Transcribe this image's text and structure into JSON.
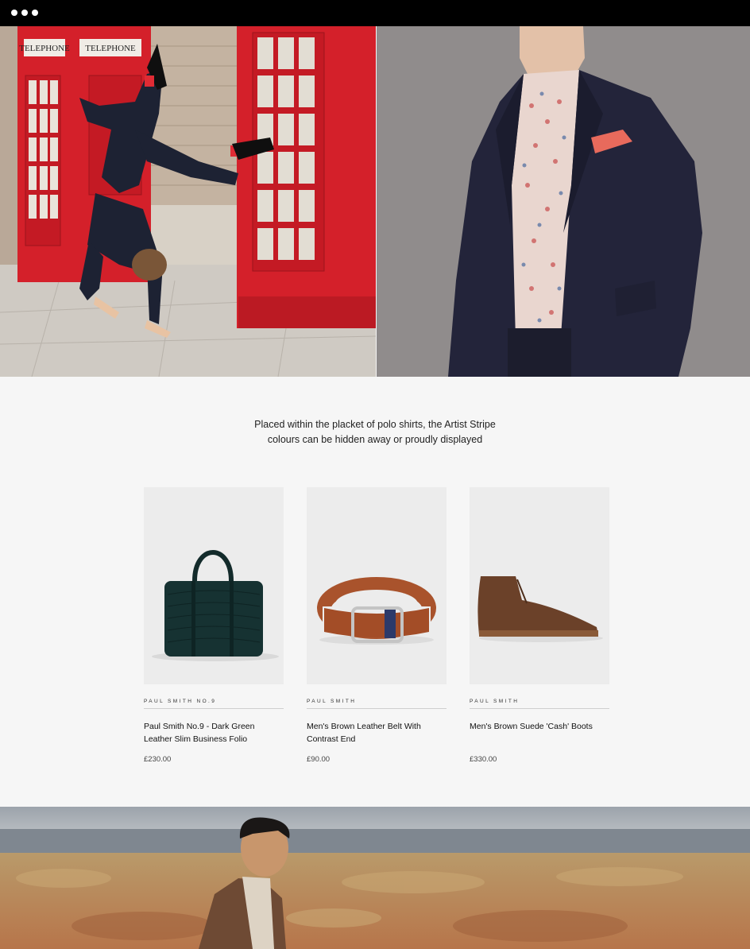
{
  "quote": {
    "line1": "Placed within the placket of polo shirts, the Artist Stripe",
    "line2": "colours can be hidden away or proudly displayed"
  },
  "products": [
    {
      "brand": "PAUL SMITH NO.9",
      "name": "Paul Smith No.9 - Dark Green Leather Slim Business Folio",
      "price": "£230.00"
    },
    {
      "brand": "PAUL SMITH",
      "name": "Men's Brown Leather Belt With Contrast End",
      "price": "£90.00"
    },
    {
      "brand": "PAUL SMITH",
      "name": "Men's Brown Suede 'Cash' Boots",
      "price": "£330.00"
    }
  ],
  "hero": {
    "left_booth_sign_1": "TELEPHONE",
    "left_booth_sign_2": "TELEPHONE"
  }
}
